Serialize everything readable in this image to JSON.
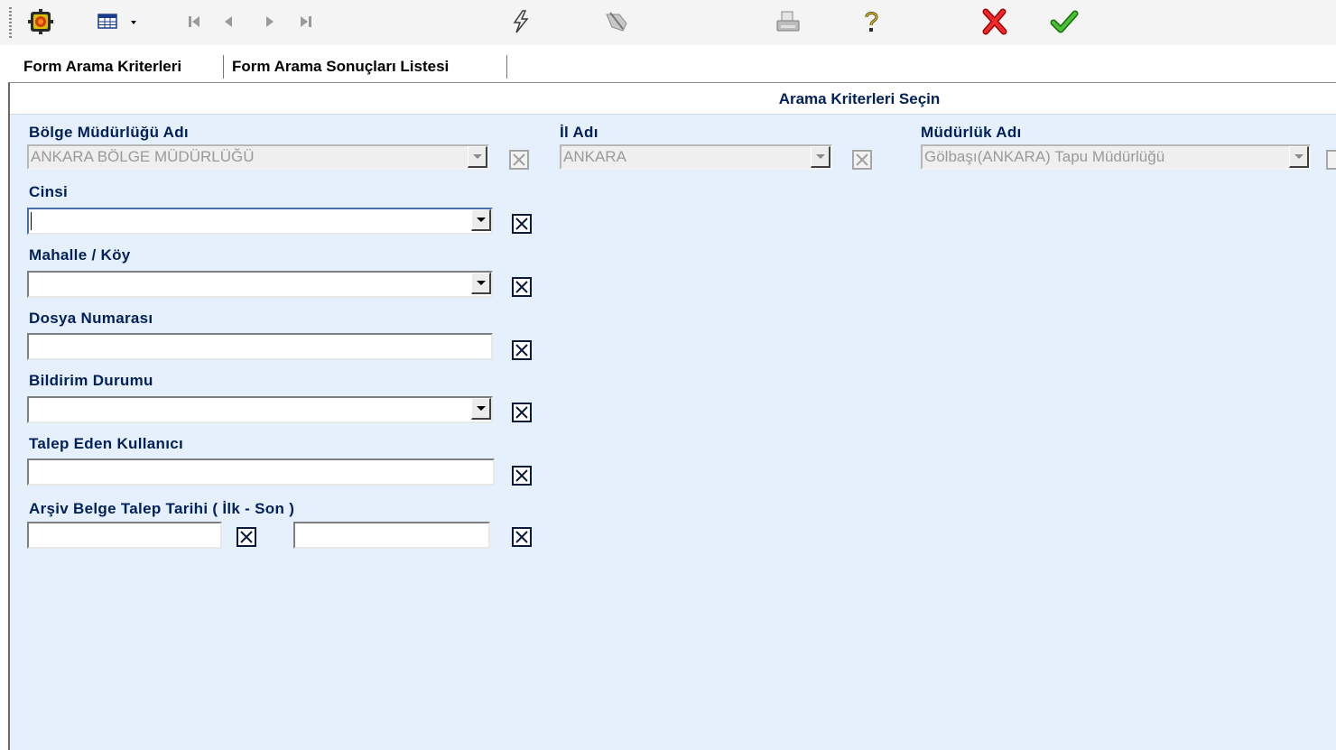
{
  "toolbar": {
    "icons": [
      "app-logo-icon",
      "grid-view-icon",
      "first-record-icon",
      "previous-record-icon",
      "next-record-icon",
      "last-record-icon",
      "lightning-icon",
      "disabled-tool-icon",
      "printer-icon",
      "help-icon",
      "cancel-icon",
      "confirm-icon"
    ]
  },
  "tabs": [
    {
      "label": "Form Arama Kriterleri"
    },
    {
      "label": "Form Arama Sonuçları Listesi"
    }
  ],
  "panel": {
    "title": "Arama Kriterleri Seçin"
  },
  "fields": {
    "bolge": {
      "label": "Bölge Müdürlüğü Adı",
      "value": "ANKARA BÖLGE MÜDÜRLÜĞÜ"
    },
    "il": {
      "label": "İl Adı",
      "value": "ANKARA"
    },
    "mudurluk": {
      "label": "Müdürlük Adı",
      "value": "Gölbaşı(ANKARA) Tapu Müdürlüğü"
    },
    "cinsi": {
      "label": "Cinsi",
      "value": ""
    },
    "mahalle": {
      "label": "Mahalle / Köy",
      "value": ""
    },
    "dosya": {
      "label": "Dosya Numarası",
      "value": ""
    },
    "bildirim": {
      "label": "Bildirim Durumu",
      "value": ""
    },
    "talep": {
      "label": "Talep Eden Kullanıcı",
      "value": ""
    },
    "tarih": {
      "label": "Arşiv Belge Talep Tarihi ( İlk - Son )",
      "first": "",
      "last": ""
    }
  },
  "colors": {
    "panel_bg": "#e6f0fc",
    "label": "#00205a",
    "cancel": "#e01010",
    "confirm": "#2a9a1a"
  }
}
